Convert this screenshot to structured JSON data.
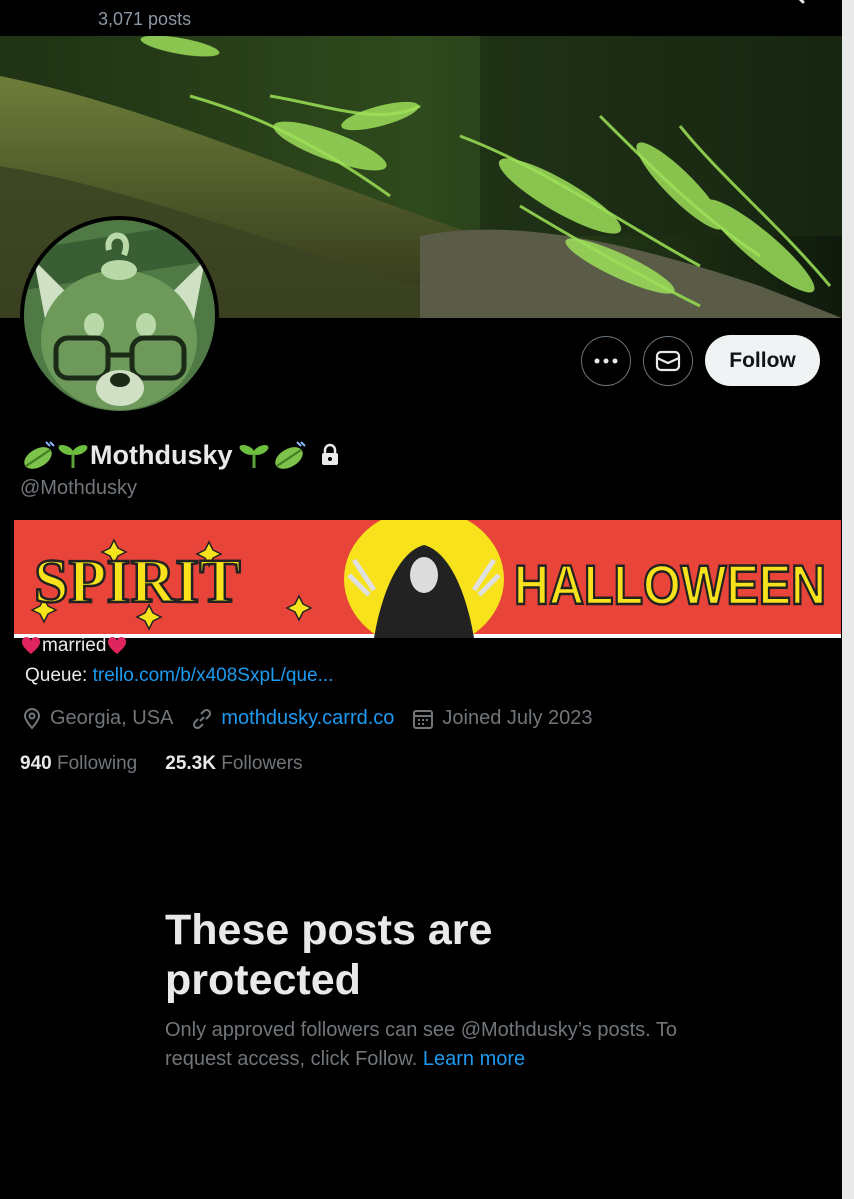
{
  "header": {
    "post_count": "3,071 posts"
  },
  "profile": {
    "display_name": "Mothdusky",
    "handle": "@Mothdusky",
    "follow_label": "Follow",
    "bio": {
      "line1": "married",
      "queue_prefix": "Queue: ",
      "queue_link": "trello.com/b/x408SxpL/que..."
    },
    "location": "Georgia, USA",
    "website": "mothdusky.carrd.co",
    "joined": "Joined July 2023",
    "following_count": "940",
    "following_label": "Following",
    "followers_count": "25.3K",
    "followers_label": "Followers"
  },
  "spirit_banner": {
    "left_text": "SPIRIT",
    "right_text": "HALLOWEEN"
  },
  "protected": {
    "title": "These posts are protected",
    "body": "Only approved followers can see @Mothdusky’s posts. To request access, click Follow.",
    "learn_more": "Learn more"
  },
  "icons": [
    "back-arrow-icon",
    "search-icon",
    "more-icon",
    "message-icon",
    "lock-icon",
    "location-icon",
    "link-icon",
    "calendar-icon",
    "leaf-icon",
    "seedling-icon",
    "heart-icon"
  ],
  "colors": {
    "accent": "#1d9bf0",
    "muted": "#71767b",
    "text": "#e7e9ea",
    "spirit_red": "#e8443a",
    "spirit_yellow": "#f7e21b"
  }
}
